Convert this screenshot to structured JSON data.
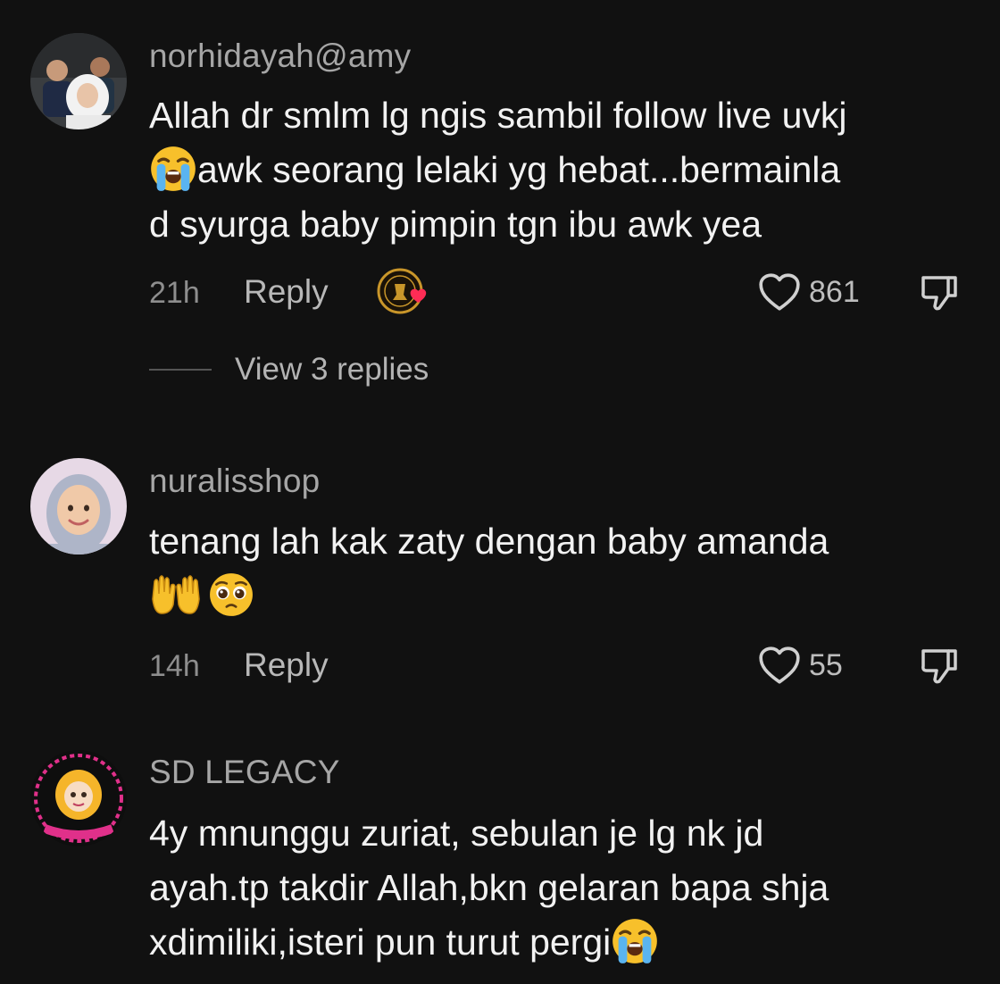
{
  "comments": [
    {
      "username": "norhidayah@amy",
      "lines": [
        "Allah dr smlm lg ngis sambil follow live uvkj",
        "awk seorang lelaki yg hebat...bermainla",
        "d syurga baby pimpin tgn ibu awk yea"
      ],
      "emoji": [
        "loudly-crying-face"
      ],
      "time": "21h",
      "reply_label": "Reply",
      "likes": "861",
      "creator_liked": true,
      "view_replies_label": "View 3 replies"
    },
    {
      "username": "nuralisshop",
      "lines": [
        "tenang lah kak zaty dengan baby amanda"
      ],
      "emoji": [
        "raising-hands",
        "pleading-face"
      ],
      "time": "14h",
      "reply_label": "Reply",
      "likes": "55"
    },
    {
      "username": "SD LEGACY",
      "lines": [
        "4y mnunggu zuriat, sebulan je lg nk jd",
        "ayah.tp takdir Allah,bkn gelaran bapa shja",
        "xdimiliki,isteri pun turut pergi"
      ],
      "emoji": [
        "loudly-crying-face"
      ]
    }
  ],
  "colors": {
    "background": "#111111",
    "text": "#f2f2f2",
    "username": "#a6a6a6",
    "meta": "#8e8e8e",
    "heart_red": "#fe2c55",
    "badge_gold": "#c9962a"
  },
  "icons": {
    "like": "heart-outline-icon",
    "dislike": "thumbs-down-icon",
    "creator": "creator-liked-badge-icon"
  }
}
